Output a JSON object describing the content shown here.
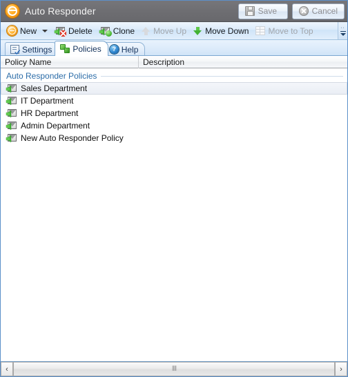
{
  "window": {
    "title": "Auto Responder",
    "logo_icon": "auto-responder-logo-icon"
  },
  "titlebar_buttons": {
    "save": {
      "label": "Save",
      "icon": "floppy-disk-icon",
      "enabled": false
    },
    "cancel": {
      "label": "Cancel",
      "icon": "cancel-circle-icon",
      "enabled": false
    }
  },
  "toolbar": {
    "items": [
      {
        "label": "New",
        "icon": "new-circle-icon",
        "enabled": true,
        "has_dropdown": true
      },
      {
        "label": "Delete",
        "icon": "envelope-delete-icon",
        "enabled": true,
        "has_dropdown": false
      },
      {
        "label": "Clone",
        "icon": "envelope-clone-icon",
        "enabled": true,
        "has_dropdown": false
      },
      {
        "label": "Move Up",
        "icon": "arrow-up-icon",
        "enabled": false,
        "has_dropdown": false
      },
      {
        "label": "Move Down",
        "icon": "arrow-down-icon",
        "enabled": true,
        "has_dropdown": false
      },
      {
        "label": "Move to Top",
        "icon": "move-to-top-icon",
        "enabled": false,
        "has_dropdown": false
      }
    ],
    "overflow_icon": "toolbar-overflow-chevron-icon"
  },
  "tabs": [
    {
      "label": "Settings",
      "icon": "settings-document-icon",
      "active": false
    },
    {
      "label": "Policies",
      "icon": "puzzle-piece-icon",
      "active": true
    },
    {
      "label": "Help",
      "icon": "help-question-icon",
      "active": false
    }
  ],
  "list": {
    "columns": [
      {
        "label": "Policy Name"
      },
      {
        "label": "Description"
      }
    ],
    "group_title": "Auto Responder Policies",
    "rows": [
      {
        "name": "Sales Department",
        "description": "",
        "icon": "envelope-reply-icon",
        "selected": true
      },
      {
        "name": "IT Department",
        "description": "",
        "icon": "envelope-reply-icon",
        "selected": false
      },
      {
        "name": "HR Department",
        "description": "",
        "icon": "envelope-reply-icon",
        "selected": false
      },
      {
        "name": "Admin Department",
        "description": "",
        "icon": "envelope-reply-icon",
        "selected": false
      },
      {
        "name": "New Auto Responder Policy",
        "description": "",
        "icon": "envelope-reply-icon",
        "selected": false
      }
    ]
  },
  "scrollbar": {
    "left_arrow": "‹",
    "right_arrow": "›",
    "grip": "‖‖"
  },
  "colors": {
    "titlebar": "#6e6e72",
    "toolbar": "#dcebfa",
    "window_border": "#5b8fc9",
    "group_title": "#2b6ca8",
    "accent_orange": "#ffa81e",
    "accent_green": "#43b233"
  }
}
